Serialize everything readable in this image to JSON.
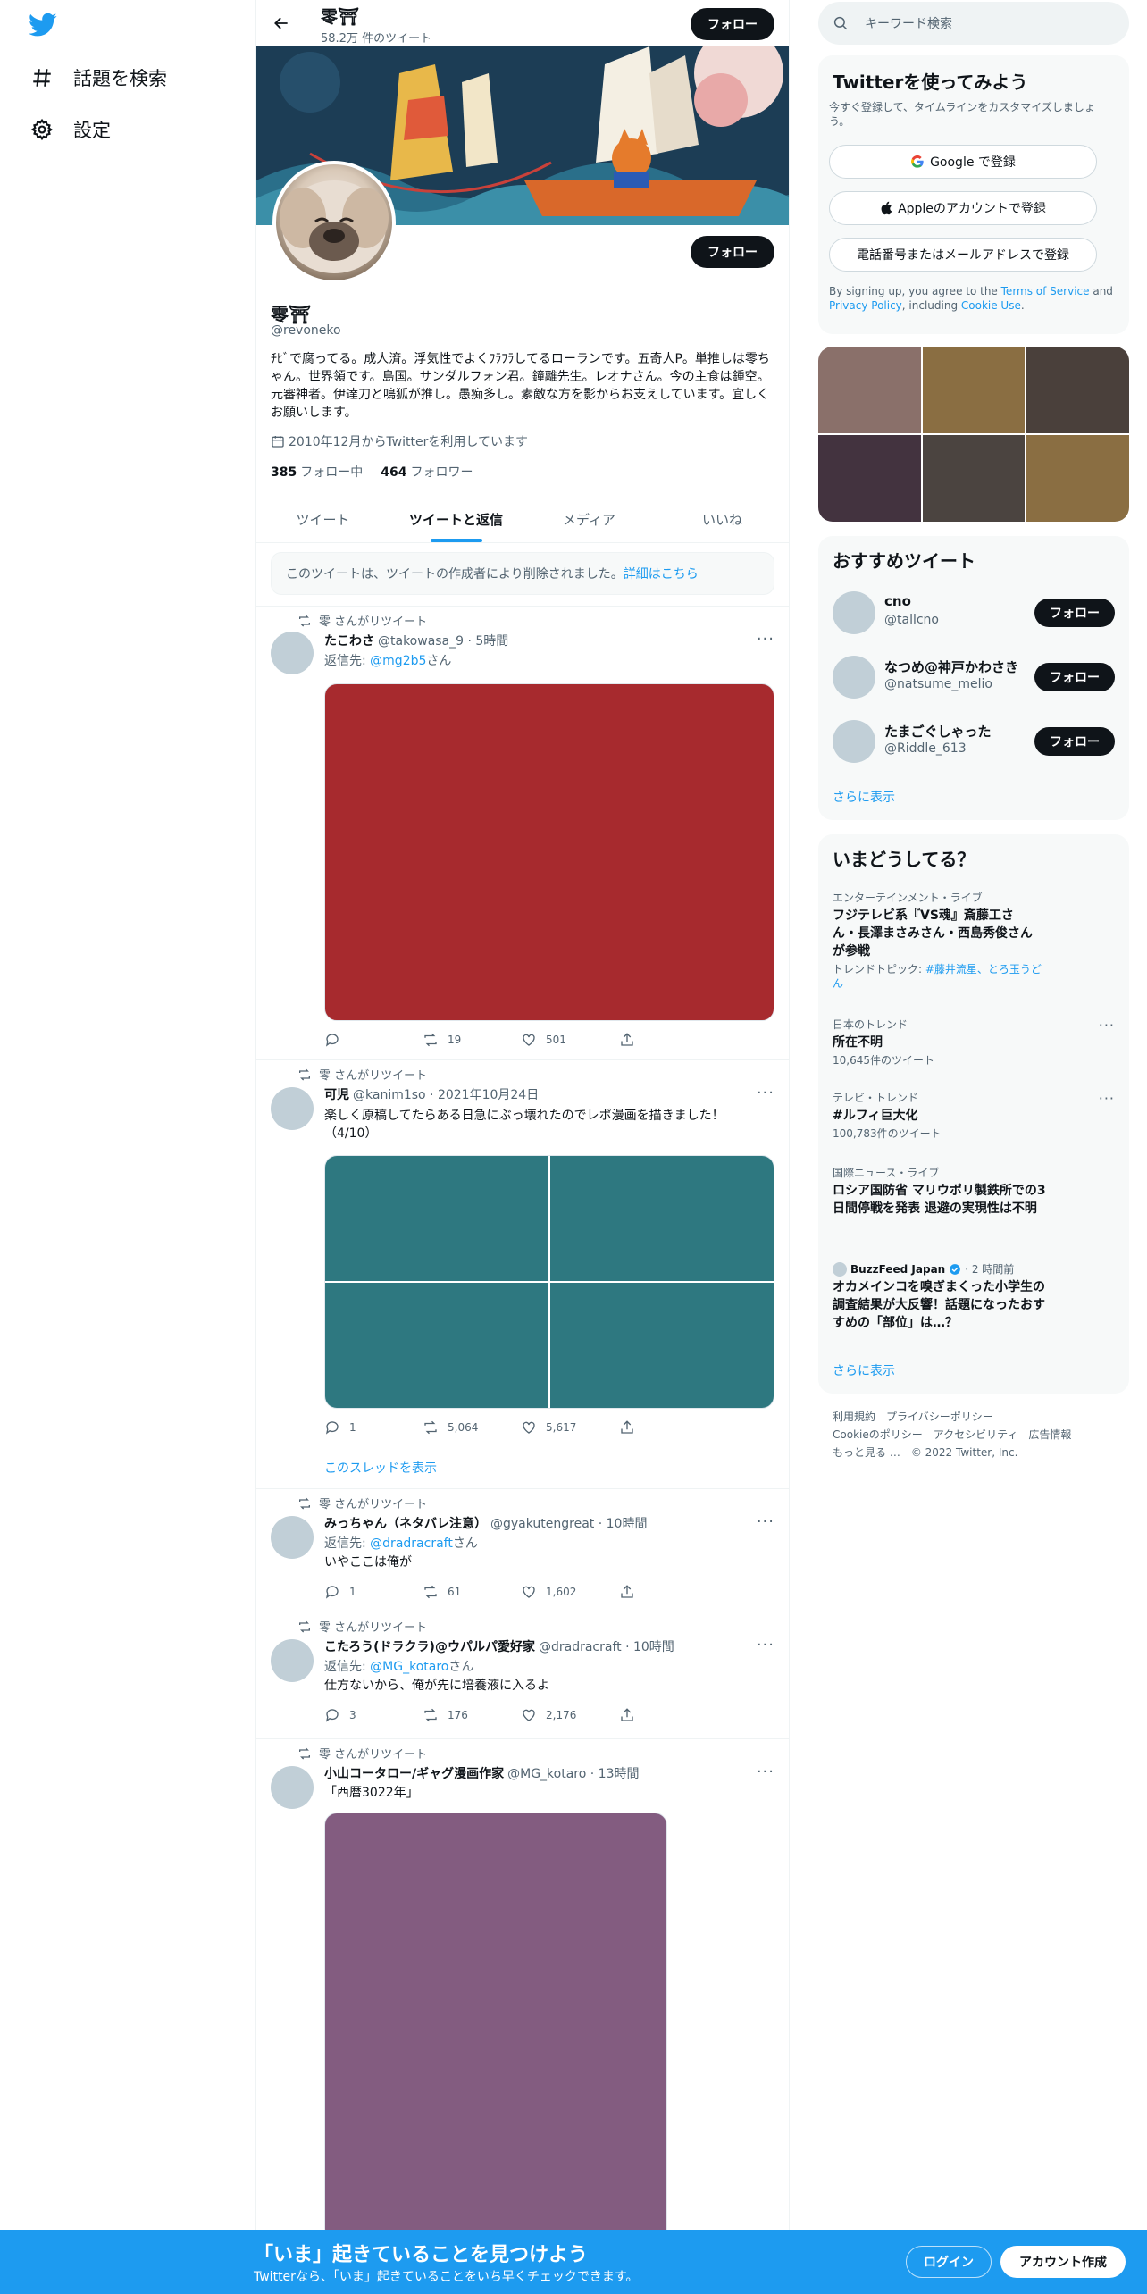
{
  "colors": {
    "accent": "#1d9bf0",
    "text": "#0f1419",
    "muted": "#536471"
  },
  "nav": {
    "explore_label": "話題を検索",
    "settings_label": "設定"
  },
  "header": {
    "title": "零⛩",
    "tweet_count": "58.2万 件のツイート",
    "follow_label": "フォロー"
  },
  "profile": {
    "name": "零⛩",
    "handle": "@revoneko",
    "bio": "ﾁﾋﾞで腐ってる。成人済。浮気性でよくﾌﾗﾌﾗしてるローランです。五奇人P。単推しは零ちゃん。世界領です。島国。サンダルフォン君。鐘離先生。レオナさん。今の主食は鍾空。元審神者。伊達刀と鳴狐が推し。愚痴多し。素敵な方を影からお支えしています。宜しくお願いします。",
    "joined": "2010年12月からTwitterを利用しています",
    "following_count": "385",
    "following_label": "フォロー中",
    "followers_count": "464",
    "followers_label": "フォロワー",
    "follow_label": "フォロー"
  },
  "tabs": [
    "ツイート",
    "ツイートと返信",
    "メディア",
    "いいね"
  ],
  "deleted_notice": {
    "text": "このツイートは、ツイートの作成者により削除されました。",
    "link": "詳細はこちら"
  },
  "tweets": [
    {
      "retweet_by": "零 さんがリツイート",
      "name": "たこわさ",
      "handle_time": "@takowasa_9 · 5時間",
      "reply_prefix": "返信先: ",
      "reply_to": "@mg2b5",
      "reply_suffix": "さん",
      "media_color": "#a72a2e",
      "replies": "",
      "retweets": "19",
      "likes": "501"
    },
    {
      "retweet_by": "零 さんがリツイート",
      "name": "可児",
      "handle_time": "@kanim1so · 2021年10月24日",
      "text": "楽しく原稿してたらある日急にぶっ壊れたのでレポ漫画を描きました！（4/10）",
      "media_color": "#2e7880",
      "replies": "1",
      "retweets": "5,064",
      "likes": "5,617",
      "thread_link": "このスレッドを表示"
    },
    {
      "retweet_by": "零 さんがリツイート",
      "name": "みっちゃん（ネタバレ注意）",
      "handle_time": "@gyakutengreat · 10時間",
      "reply_prefix": "返信先: ",
      "reply_to": "@dradracraft",
      "reply_suffix": "さん",
      "text": "いやここは俺が",
      "replies": "1",
      "retweets": "61",
      "likes": "1,602"
    },
    {
      "retweet_by": "零 さんがリツイート",
      "name": "こたろう(ドラクラ)@ウパルパ愛好家",
      "handle_time": "@dradracraft · 10時間",
      "reply_prefix": "返信先: ",
      "reply_to": "@MG_kotaro",
      "reply_suffix": "さん",
      "text": "仕方ないから、俺が先に培養液に入るよ",
      "replies": "3",
      "retweets": "176",
      "likes": "2,176"
    },
    {
      "retweet_by": "零 さんがリツイート",
      "name": "小山コータロー/ギャグ漫画作家",
      "handle_time": "@MG_kotaro · 13時間",
      "text": "「西暦3022年」",
      "media_color": "#835c80"
    }
  ],
  "right": {
    "search_placeholder": "キーワード検索",
    "signup": {
      "title": "Twitterを使ってみよう",
      "subtitle": "今すぐ登録して、タイムラインをカスタマイズしましょう。",
      "google": "Google で登録",
      "apple": "Appleのアカウントで登録",
      "phone": "電話番号またはメールアドレスで登録",
      "terms_1": "By signing up, you agree to the ",
      "terms_link": "Terms of Service",
      "terms_2": " and ",
      "privacy_link": "Privacy Policy",
      "terms_3": ", including ",
      "cookie_link": "Cookie Use",
      "terms_4": "."
    },
    "photos": [
      "#8a706a",
      "#8a6e42",
      "#4a403b",
      "#43333f",
      "#4b4440",
      "#8a6e42"
    ],
    "who": {
      "title": "おすすめツイート",
      "users": [
        {
          "name": "cno",
          "handle": "@tallcno"
        },
        {
          "name": "なつめ@神戸かわさき",
          "handle": "@natsume_melio"
        },
        {
          "name": "たまごぐしゃった",
          "handle": "@Riddle_613"
        }
      ],
      "follow_label": "フォロー",
      "show_more": "さらに表示"
    },
    "trends": {
      "title": "いまどうしてる？",
      "items": [
        {
          "category": "エンターテインメント・ライブ",
          "title": "フジテレビ系『VS魂』斎藤工さん・長澤まさみさん・西島秀俊さんが参戦",
          "sub_prefix": "トレンドトピック: ",
          "sub_link": "#藤井流星、とろ玉うどん"
        },
        {
          "category": "日本のトレンド",
          "title": "所在不明",
          "sub": "10,645件のツイート"
        },
        {
          "category": "テレビ・トレンド",
          "title": "#ルフィ巨大化",
          "sub": "100,783件のツイート"
        },
        {
          "category": "国際ニュース・ライブ",
          "title": "ロシア国防省 マリウポリ製鉄所での3日間停戦を発表 退避の実現性は不明"
        },
        {
          "source": "BuzzFeed Japan",
          "time": "· 2 時間前",
          "title": "オカメインコを嗅ぎまくった小学生の調査結果が大反響！話題になったおすすめの「部位」は…？"
        }
      ],
      "show_more": "さらに表示"
    },
    "footer": {
      "line1": [
        "利用規約",
        "プライバシーポリシー"
      ],
      "line2": [
        "Cookieのポリシー",
        "アクセシビリティ",
        "広告情報"
      ],
      "line3": [
        "もっと見る …",
        "© 2022 Twitter, Inc."
      ]
    }
  },
  "bottom": {
    "title": "「いま」起きていることを見つけよう",
    "subtitle": "Twitterなら、「いま」起きていることをいち早くチェックできます。",
    "login": "ログイン",
    "signup": "アカウント作成"
  }
}
